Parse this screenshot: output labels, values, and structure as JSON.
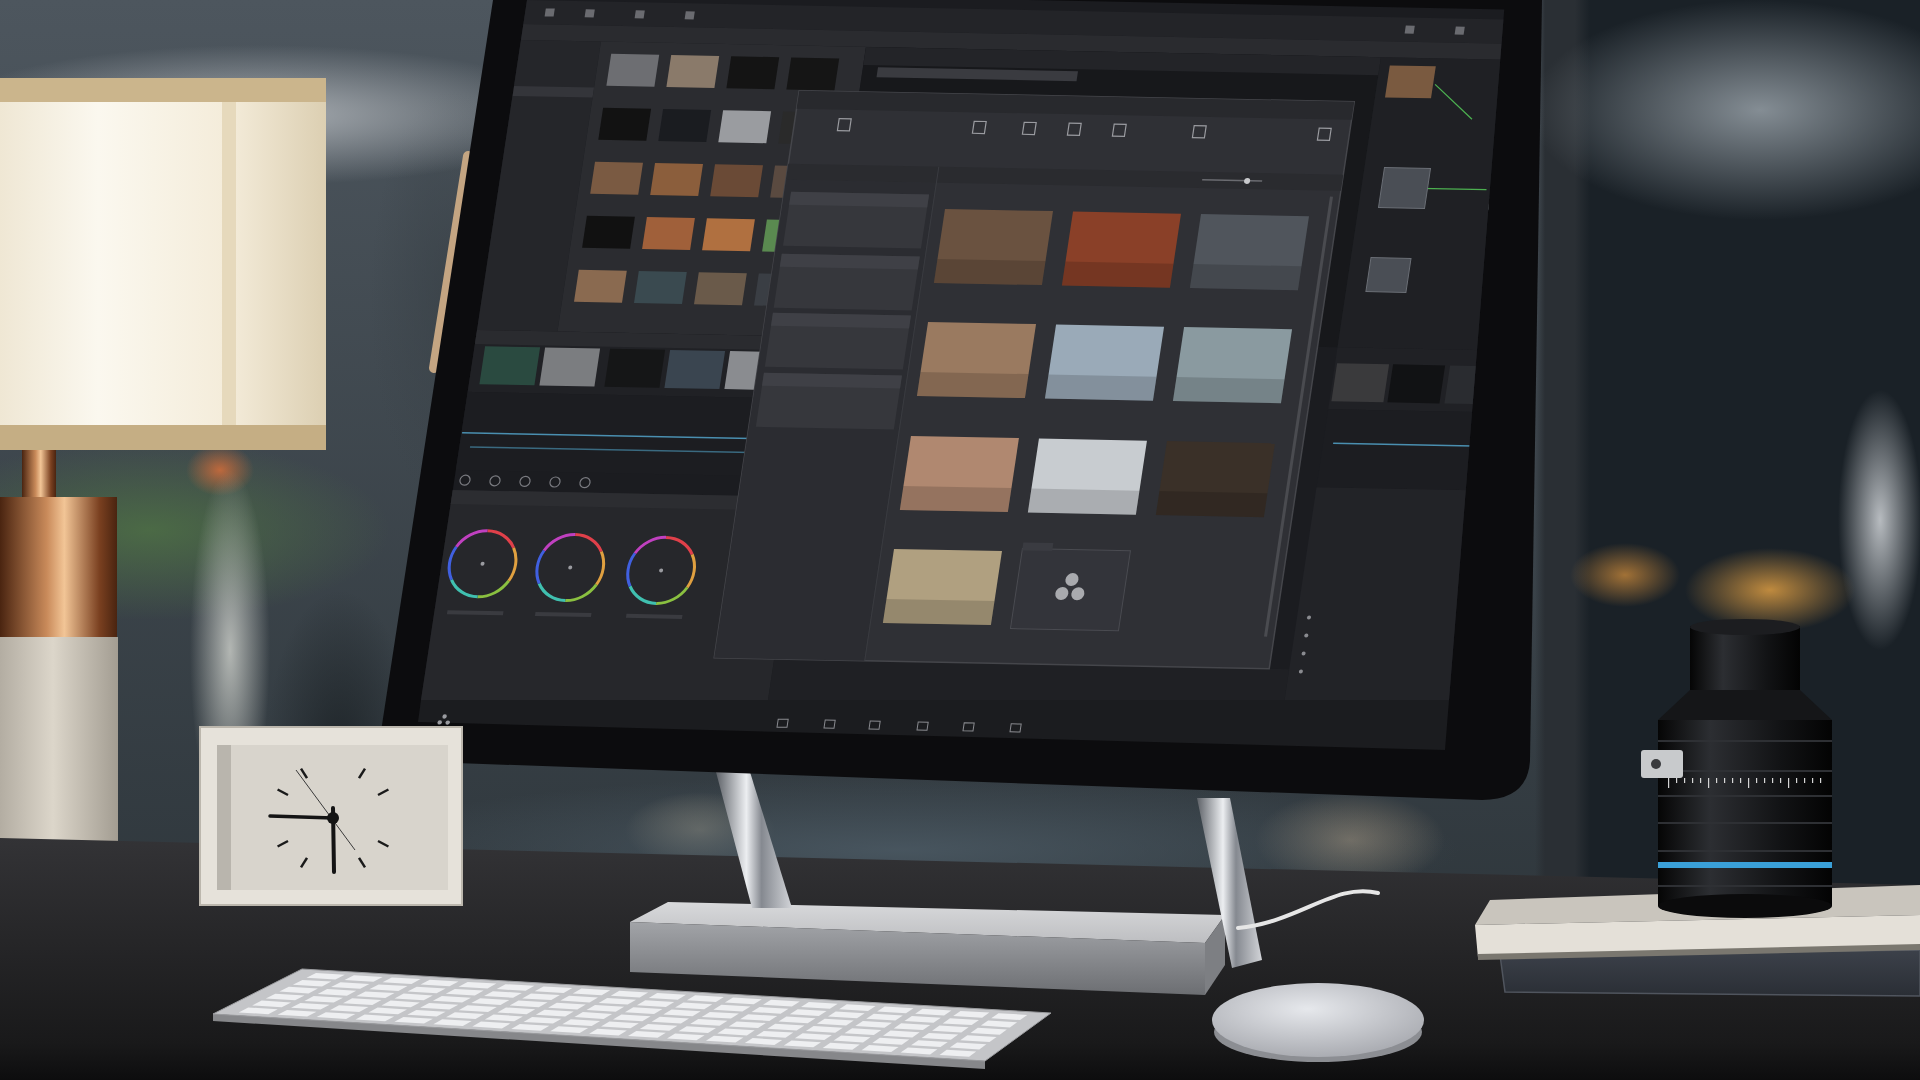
{
  "photo": {
    "objects": [
      {
        "kind": "window"
      },
      {
        "kind": "lamp"
      },
      {
        "kind": "desk"
      },
      {
        "kind": "monitor-stand"
      },
      {
        "kind": "cable"
      },
      {
        "kind": "stylus"
      },
      {
        "kind": "monitor"
      },
      {
        "kind": "clock"
      },
      {
        "kind": "keyboard"
      },
      {
        "kind": "mouse"
      },
      {
        "kind": "books"
      },
      {
        "kind": "lens"
      }
    ]
  }
}
